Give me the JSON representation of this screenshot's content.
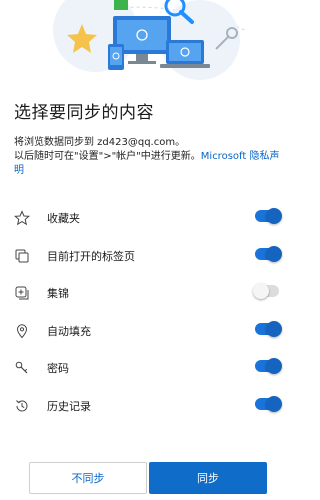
{
  "page": {
    "title": "选择要同步的内容",
    "description_line1": "将浏览数据同步到 zd423@qq.com。",
    "description_line2": "以后随时可在\"设置\">\"帐户\"中进行更新。",
    "privacy_link": "Microsoft 隐私声明"
  },
  "sync_items": [
    {
      "label": "收藏夹",
      "icon": "star-outline-icon",
      "enabled": true
    },
    {
      "label": "目前打开的标签页",
      "icon": "tabs-icon",
      "enabled": true
    },
    {
      "label": "集锦",
      "icon": "collections-icon",
      "enabled": false
    },
    {
      "label": "自动填充",
      "icon": "location-pin-icon",
      "enabled": true
    },
    {
      "label": "密码",
      "icon": "key-icon",
      "enabled": true
    },
    {
      "label": "历史记录",
      "icon": "history-icon",
      "enabled": true
    }
  ],
  "actions": {
    "decline_label": "不同步",
    "accept_label": "同步"
  },
  "colors": {
    "accent": "#0f6cc9",
    "link": "#0a65c7"
  }
}
